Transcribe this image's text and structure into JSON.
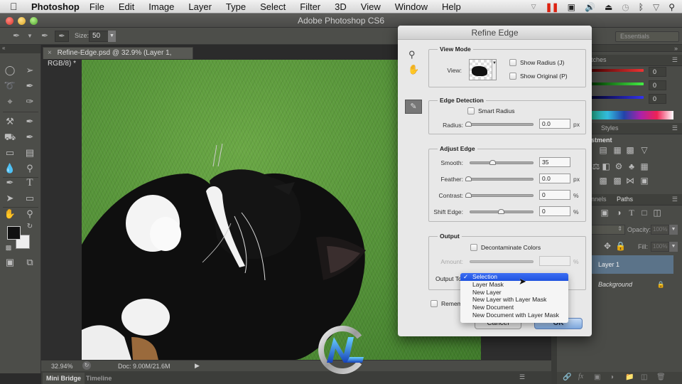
{
  "menubar": {
    "app_name": "Photoshop",
    "items": [
      "File",
      "Edit",
      "Image",
      "Layer",
      "Type",
      "Select",
      "Filter",
      "3D",
      "View",
      "Window",
      "Help"
    ],
    "status_icons": [
      "dropdown-icon",
      "record-pause-icon",
      "screen-record-icon",
      "volume-icon",
      "eject-icon",
      "time-machine-icon",
      "bluetooth-icon",
      "wifi-icon",
      "spotlight-search-icon"
    ]
  },
  "window": {
    "title": "Adobe Photoshop CS6"
  },
  "options_bar": {
    "size_label": "Size:",
    "size_value": "50",
    "workspace": "Essentials"
  },
  "document": {
    "tab_title": "Refine-Edge.psd @ 32.9% (Layer 1, RGB/8) *",
    "zoom": "32.94%",
    "doc_info": "Doc: 9.00M/21.6M"
  },
  "bottom_tabs": [
    "Mini Bridge",
    "Timeline"
  ],
  "right_panels": {
    "color_tab": "Swatches",
    "color_tab_visible": "tches",
    "rgb_values": [
      "0",
      "0",
      "0"
    ],
    "adjust_tabs": [
      "Styles"
    ],
    "adjust_header": "stment",
    "layers_tabs": [
      "nnels",
      "Paths"
    ],
    "opacity_label": "Opacity:",
    "opacity_value": "100%",
    "fill_label": "Fill:",
    "fill_value": "100%",
    "layers": [
      {
        "name": "Layer 1",
        "selected": true
      },
      {
        "name": "Background",
        "selected": false,
        "locked": true
      }
    ]
  },
  "dialog": {
    "title": "Refine Edge",
    "view_mode": {
      "label": "View Mode",
      "view_label": "View:",
      "show_radius": "Show Radius (J)",
      "show_original": "Show Original (P)"
    },
    "edge_detection": {
      "label": "Edge Detection",
      "smart_radius": "Smart Radius",
      "radius_label": "Radius:",
      "radius_value": "0.0",
      "radius_unit": "px",
      "radius_slider": 0
    },
    "adjust_edge": {
      "label": "Adjust Edge",
      "smooth_label": "Smooth:",
      "smooth_value": "35",
      "smooth_slider": 0.35,
      "feather_label": "Feather:",
      "feather_value": "0.0",
      "feather_unit": "px",
      "feather_slider": 0,
      "contrast_label": "Contrast:",
      "contrast_value": "0",
      "contrast_unit": "%",
      "contrast_slider": 0,
      "shift_label": "Shift Edge:",
      "shift_value": "0",
      "shift_unit": "%",
      "shift_slider": 0.5
    },
    "output": {
      "label": "Output",
      "decontaminate": "Decontaminate Colors",
      "amount_label": "Amount:",
      "amount_unit": "%",
      "output_to_label": "Output To:",
      "output_to_visible": "Output To",
      "options": [
        "Selection",
        "Layer Mask",
        "New Layer",
        "New Layer with Layer Mask",
        "New Document",
        "New Document with Layer Mask"
      ],
      "selected": "Selection"
    },
    "remember_label": "Remember Settings",
    "remember_visible": "Rememl",
    "cancel_label": "Cancel",
    "ok_label": "OK"
  },
  "colors": {
    "selection_blue": "#2b5fe8",
    "layer_selected": "#5b7389",
    "ok_button": "#8fb3e0"
  }
}
